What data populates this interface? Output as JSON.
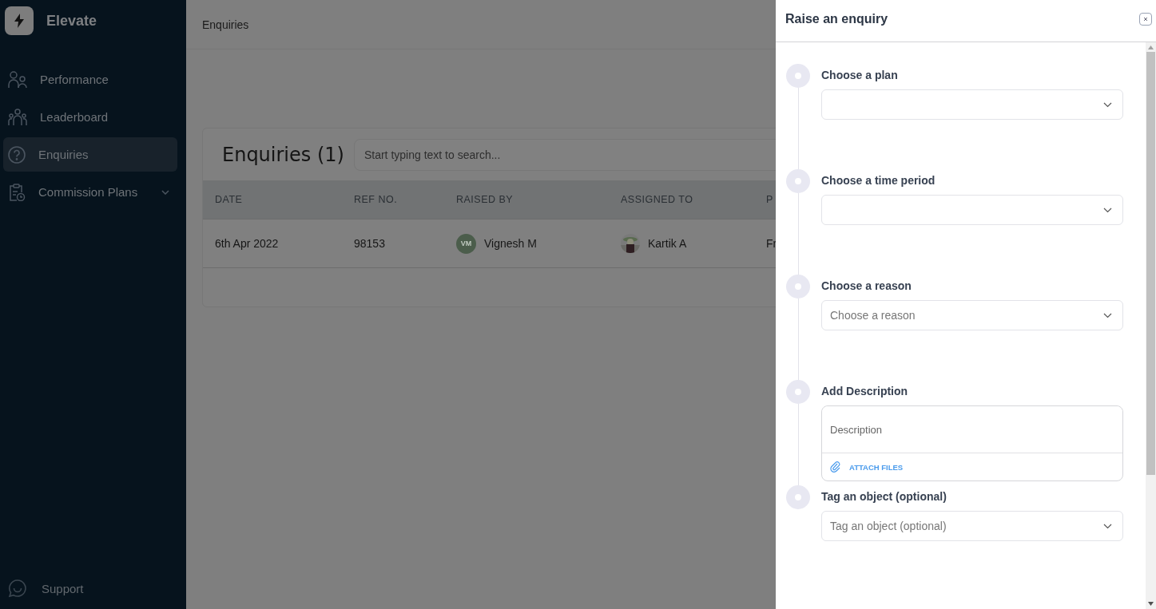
{
  "sidebar": {
    "brand": "Elevate",
    "items": [
      {
        "label": "Performance",
        "selected": false,
        "expandable": false
      },
      {
        "label": "Leaderboard",
        "selected": false,
        "expandable": false
      },
      {
        "label": "Enquiries",
        "selected": true,
        "expandable": false
      },
      {
        "label": "Commission Plans",
        "selected": false,
        "expandable": true
      }
    ],
    "footer": {
      "label": "Support"
    }
  },
  "header": {
    "breadcrumb": "Enquiries"
  },
  "enquiries": {
    "title": "Enquiries (1)",
    "search": {
      "placeholder": "Start typing text to search..."
    },
    "columns": [
      "DATE",
      "REF NO.",
      "RAISED BY",
      "ASSIGNED TO",
      "P"
    ],
    "rows": [
      {
        "date": "6th Apr 2022",
        "ref": "98153",
        "raised_by": {
          "initials": "VM",
          "name": "Vignesh M"
        },
        "assigned_to": {
          "name": "Kartik A",
          "kind": "picture"
        },
        "column_5": "Fr"
      }
    ]
  },
  "drawer": {
    "title": "Raise an enquiry",
    "steps": [
      {
        "kind": "select",
        "label": "Choose a plan"
      },
      {
        "kind": "select",
        "label": "Choose a time period"
      },
      {
        "kind": "select",
        "label": "Choose a reason",
        "placeholder": "Choose a reason"
      },
      {
        "kind": "textarea",
        "label": "Add Description",
        "placeholder": "Description",
        "attach": "ATTACH FILES"
      },
      {
        "kind": "select",
        "label": "Tag an object (optional)",
        "placeholder": "Tag an object (optional)"
      }
    ]
  }
}
